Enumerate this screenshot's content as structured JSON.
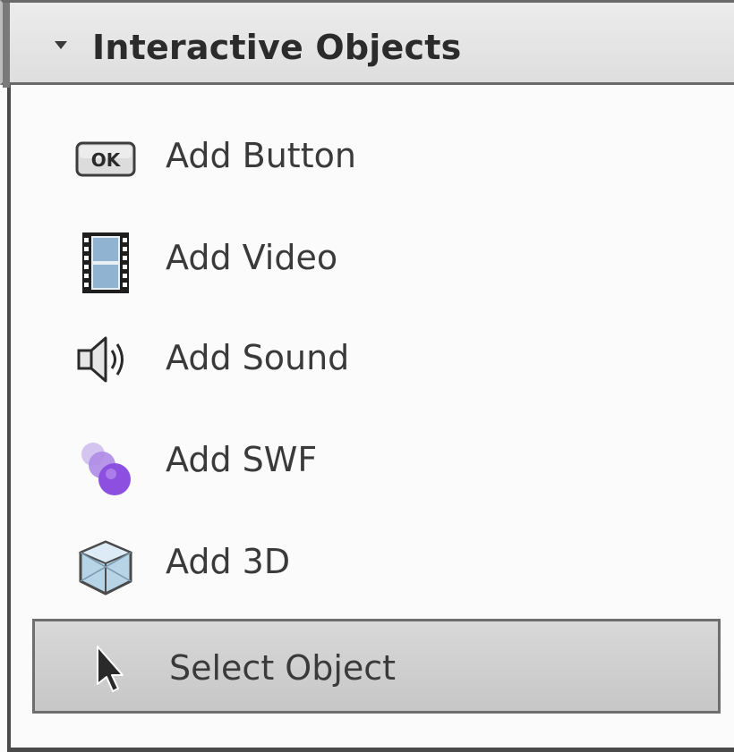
{
  "panel": {
    "title": "Interactive Objects",
    "items": [
      {
        "label": "Add Button",
        "icon": "ok-button-icon"
      },
      {
        "label": "Add Video",
        "icon": "film-icon"
      },
      {
        "label": "Add Sound",
        "icon": "speaker-icon"
      },
      {
        "label": "Add SWF",
        "icon": "swf-icon"
      },
      {
        "label": "Add 3D",
        "icon": "cube-3d-icon"
      },
      {
        "label": "Select Object",
        "icon": "arrow-cursor-icon",
        "selected": true
      }
    ],
    "ok_icon_text": "OK"
  }
}
